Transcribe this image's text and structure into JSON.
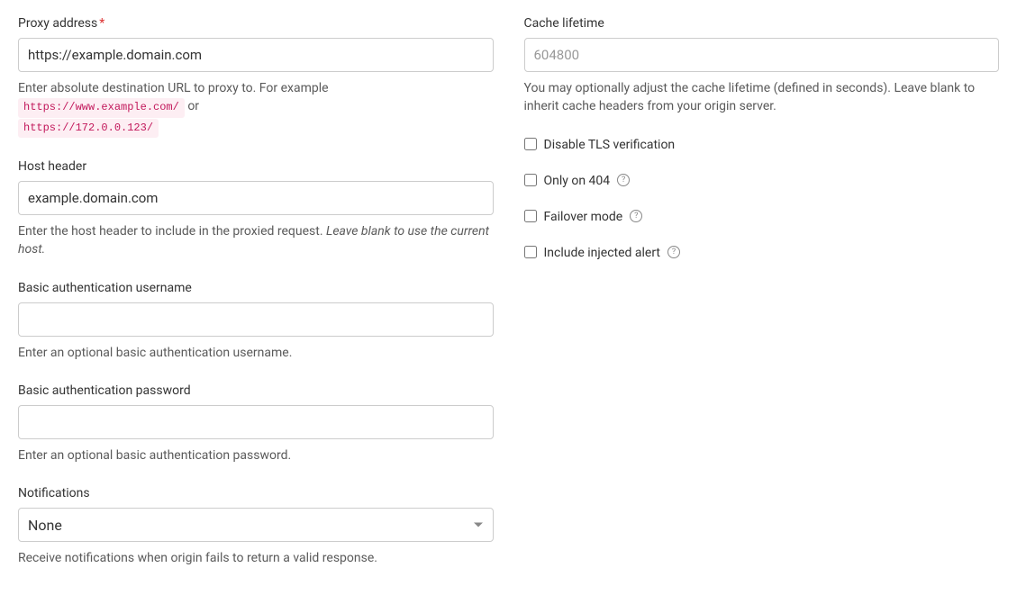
{
  "left": {
    "proxyAddress": {
      "label": "Proxy address",
      "required": "*",
      "value": "https://example.domain.com",
      "help_prefix": "Enter absolute destination URL to proxy to. For example ",
      "help_code1": "https://www.example.com/",
      "help_mid": " or ",
      "help_code2": "https://172.0.0.123/"
    },
    "hostHeader": {
      "label": "Host header",
      "value": "example.domain.com",
      "help_text": "Enter the host header to include in the proxied request. ",
      "help_em": "Leave blank to use the current host."
    },
    "basicUser": {
      "label": "Basic authentication username",
      "value": "",
      "help": "Enter an optional basic authentication username."
    },
    "basicPass": {
      "label": "Basic authentication password",
      "value": "",
      "help": "Enter an optional basic authentication password."
    },
    "notifications": {
      "label": "Notifications",
      "selected": "None",
      "help": "Receive notifications when origin fails to return a valid response."
    }
  },
  "right": {
    "cacheLifetime": {
      "label": "Cache lifetime",
      "placeholder": "604800",
      "help": "You may optionally adjust the cache lifetime (defined in seconds). Leave blank to inherit cache headers from your origin server."
    },
    "disableTls": {
      "label": "Disable TLS verification"
    },
    "onlyOn404": {
      "label": "Only on 404"
    },
    "failover": {
      "label": "Failover mode"
    },
    "includeAlert": {
      "label": "Include injected alert"
    },
    "helpGlyph": "?"
  }
}
